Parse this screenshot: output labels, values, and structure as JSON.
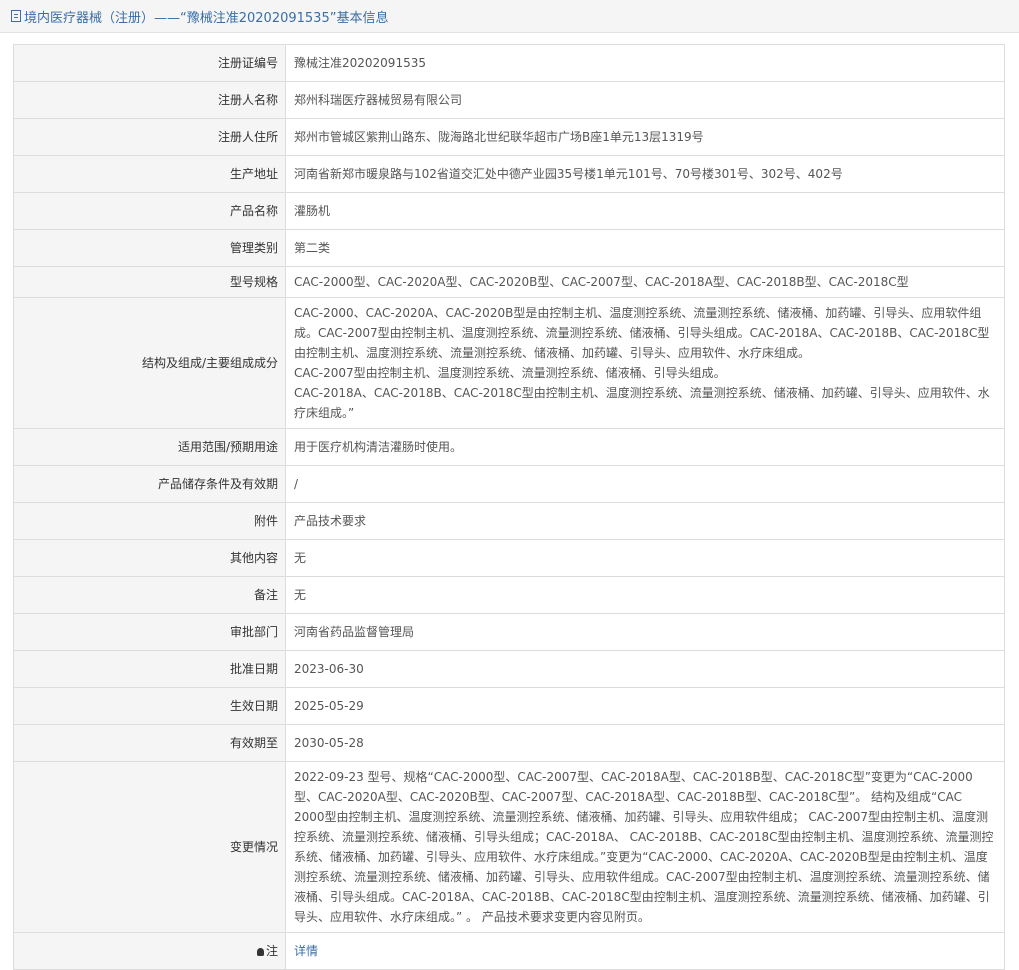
{
  "header": {
    "title": "境内医疗器械（注册）——“豫械注准20202091535”基本信息"
  },
  "rows": [
    {
      "label": "注册证编号",
      "value": "豫械注准20202091535"
    },
    {
      "label": "注册人名称",
      "value": "郑州科瑞医疗器械贸易有限公司"
    },
    {
      "label": "注册人住所",
      "value": "郑州市管城区紫荆山路东、陇海路北世纪联华超市广场B座1单元13层1319号"
    },
    {
      "label": "生产地址",
      "value": "河南省新郑市暖泉路与102省道交汇处中德产业园35号楼1单元101号、70号楼301号、302号、402号"
    },
    {
      "label": "产品名称",
      "value": "灌肠机"
    },
    {
      "label": "管理类别",
      "value": "第二类"
    },
    {
      "label": "型号规格",
      "value": "CAC-2000型、CAC-2020A型、CAC-2020B型、CAC-2007型、CAC-2018A型、CAC-2018B型、CAC-2018C型"
    },
    {
      "label": "结构及组成/主要组成成分",
      "value": "CAC-2000、CAC-2020A、CAC-2020B型是由控制主机、温度测控系统、流量测控系统、储液桶、加药罐、引导头、应用软件组成。CAC-2007型由控制主机、温度测控系统、流量测控系统、储液桶、引导头组成。CAC-2018A、CAC-2018B、CAC-2018C型由控制主机、温度测控系统、流量测控系统、储液桶、加药罐、引导头、应用软件、水疗床组成。\nCAC-2007型由控制主机、温度测控系统、流量测控系统、储液桶、引导头组成。\nCAC-2018A、CAC-2018B、CAC-2018C型由控制主机、温度测控系统、流量测控系统、储液桶、加药罐、引导头、应用软件、水疗床组成。”"
    },
    {
      "label": "适用范围/预期用途",
      "value": "用于医疗机构清洁灌肠时使用。"
    },
    {
      "label": "产品储存条件及有效期",
      "value": "/"
    },
    {
      "label": "附件",
      "value": "产品技术要求"
    },
    {
      "label": "其他内容",
      "value": "无"
    },
    {
      "label": "备注",
      "value": "无"
    },
    {
      "label": "审批部门",
      "value": "河南省药品监督管理局"
    },
    {
      "label": "批准日期",
      "value": "2023-06-30"
    },
    {
      "label": "生效日期",
      "value": "2025-05-29"
    },
    {
      "label": "有效期至",
      "value": "2030-05-28"
    },
    {
      "label": "变更情况",
      "value": "2022-09-23 型号、规格“CAC-2000型、CAC-2007型、CAC-2018A型、CAC-2018B型、CAC-2018C型”变更为“CAC-2000型、CAC-2020A型、CAC-2020B型、CAC-2007型、CAC-2018A型、CAC-2018B型、CAC-2018C型”。 结构及组成“CAC 2000型由控制主机、温度测控系统、流量测控系统、储液桶、加药罐、引导头、应用软件组成； CAC-2007型由控制主机、温度测控系统、流量测控系统、储液桶、引导头组成；CAC-2018A、 CAC-2018B、CAC-2018C型由控制主机、温度测控系统、流量测控系统、储液桶、加药罐、引导头、应用软件、水疗床组成。”变更为“CAC-2000、CAC-2020A、CAC-2020B型是由控制主机、温度测控系统、流量测控系统、储液桶、加药罐、引导头、应用软件组成。CAC-2007型由控制主机、温度测控系统、流量测控系统、储液桶、引导头组成。CAC-2018A、CAC-2018B、CAC-2018C型由控制主机、温度测控系统、流量测控系统、储液桶、加药罐、引导头、应用软件、水疗床组成。” 。 产品技术要求变更内容见附页。"
    }
  ],
  "note_row": {
    "label": "注",
    "link": "详情"
  }
}
